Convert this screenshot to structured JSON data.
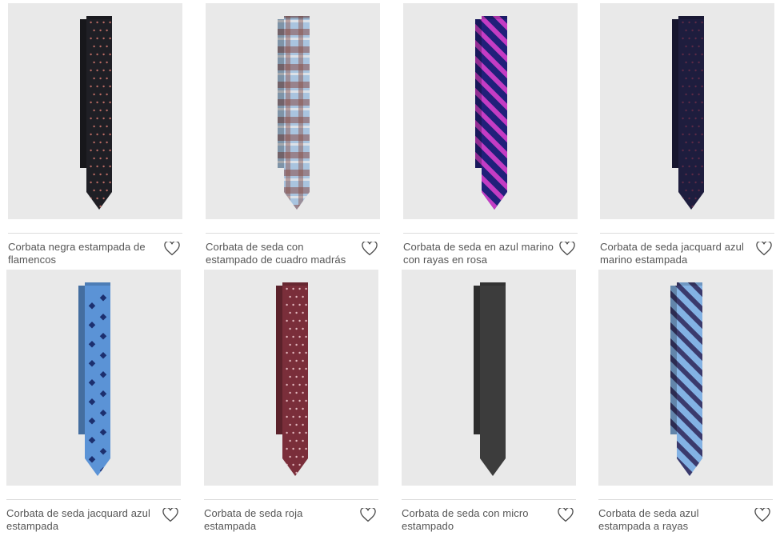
{
  "products": [
    {
      "name": "Corbata negra estampada de flamencos",
      "pattern": "dots",
      "colors": {
        "base": "#1f1f25",
        "accent": "#b86a62"
      },
      "favorite_icon": "heart-outline-icon"
    },
    {
      "name": "Corbata de seda con estampado de cuadro madrás",
      "pattern": "plaid",
      "colors": {
        "base": "#a9c4df",
        "accent": "#8a4f48"
      },
      "favorite_icon": "heart-outline-icon"
    },
    {
      "name": "Corbata de seda en azul marino con rayas en rosa",
      "pattern": "stripes",
      "colors": {
        "base": "#20207a",
        "accent": "#c43cc4"
      },
      "favorite_icon": "heart-outline-icon"
    },
    {
      "name": "Corbata de seda jacquard azul marino estampada",
      "pattern": "dots",
      "colors": {
        "base": "#1e1d3e",
        "accent": "#5a2a46"
      },
      "favorite_icon": "heart-outline-icon"
    },
    {
      "name": "Corbata de seda jacquard azul estampada",
      "pattern": "medallion",
      "colors": {
        "base": "#5b93d6",
        "accent": "#1c2f6e"
      },
      "favorite_icon": "heart-outline-icon"
    },
    {
      "name": "Corbata de seda roja estampada",
      "pattern": "dots",
      "colors": {
        "base": "#7a2e3a",
        "accent": "#e0b7bd"
      },
      "favorite_icon": "heart-outline-icon"
    },
    {
      "name": "Corbata de seda con micro estampado",
      "pattern": "check",
      "colors": {
        "base": "#3c3c3c",
        "accent": "#d8d8d8"
      },
      "favorite_icon": "heart-outline-icon"
    },
    {
      "name": "Corbata de seda azul estampada a rayas",
      "pattern": "stripes",
      "colors": {
        "base": "#83b2e4",
        "accent": "#3b3a6c"
      },
      "favorite_icon": "heart-outline-icon"
    }
  ]
}
